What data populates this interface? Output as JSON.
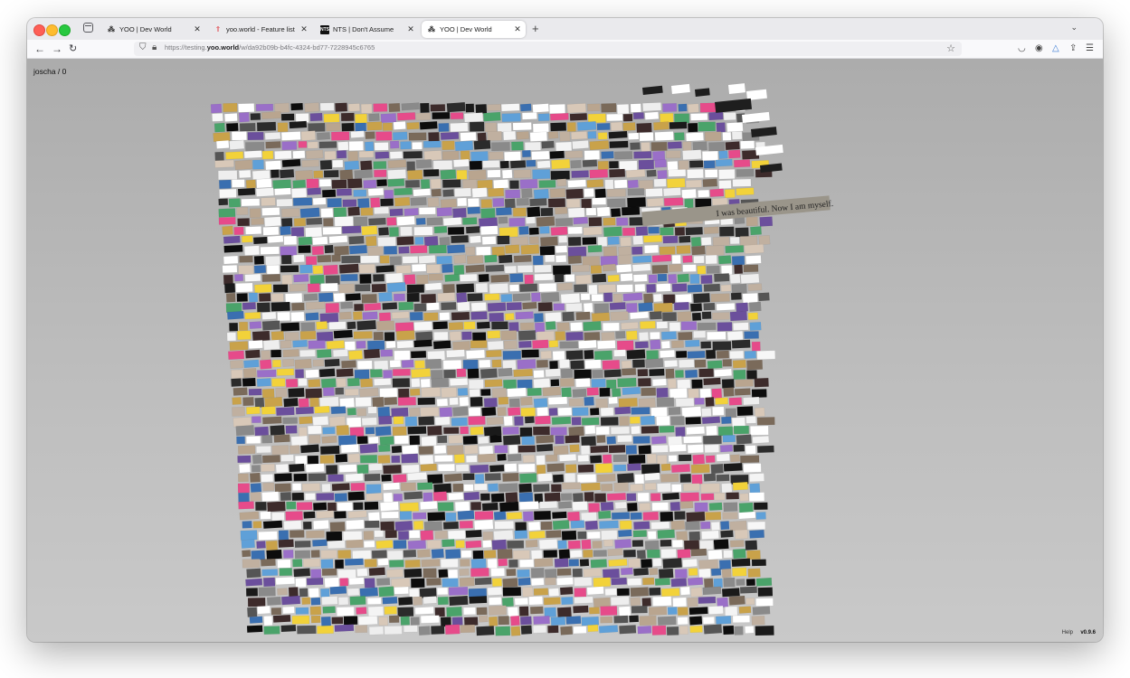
{
  "window": {
    "tabs": [
      {
        "title": "YOO | Dev World",
        "icon": "yoo-logo-icon",
        "active": false
      },
      {
        "title": "yoo.world - Feature list",
        "icon": "feature-list-icon",
        "active": false
      },
      {
        "title": "NTS | Don't Assume",
        "icon": "nts-logo-icon",
        "active": false
      },
      {
        "title": "YOO | Dev World",
        "icon": "yoo-logo-icon",
        "active": true
      }
    ],
    "new_tab_label": "+",
    "url": {
      "prefix": "https://testing.",
      "domain": "yoo.world",
      "path": "/w/da92b09b-b4fc-4324-bd77-7228945c6765"
    }
  },
  "canvas": {
    "user_label": "joscha / 0",
    "help_label": "Help",
    "version_label": "v0.9.6",
    "quote_text": "I was beautiful. Now I am myself."
  },
  "colors": {
    "canvas_background": "#bcbcbc",
    "quote_strip": "#9a958a",
    "traffic_close": "#fe5f57",
    "traffic_minimize": "#febc2e",
    "traffic_maximize": "#28c840"
  },
  "icons": {
    "tab_list": "tab-list-icon",
    "back": "arrow-left-icon",
    "forward": "arrow-right-icon",
    "reload": "reload-icon",
    "shield": "shield-icon",
    "lock": "lock-icon",
    "bookmark": "star-icon",
    "pocket": "pocket-icon",
    "account": "account-icon",
    "extension": "triangle-extension-icon",
    "share": "share-icon",
    "menu": "hamburger-menu-icon"
  }
}
